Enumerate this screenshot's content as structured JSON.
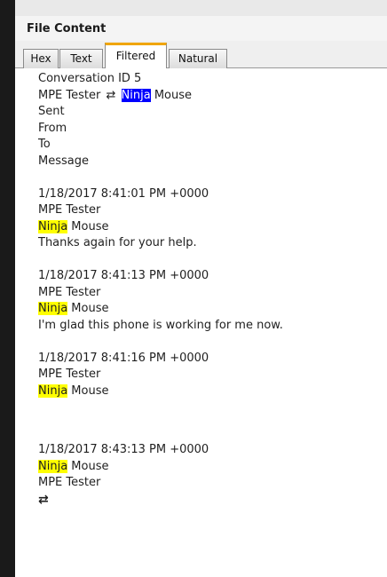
{
  "panel": {
    "title": "File Content"
  },
  "tabs": [
    {
      "label": "Hex"
    },
    {
      "label": "Text"
    },
    {
      "label": "Filtered"
    },
    {
      "label": "Natural"
    }
  ],
  "conversation": {
    "id_line": "Conversation ID 5",
    "participant_a": "MPE Tester",
    "swap_glyph": "⇄",
    "highlight_word": "Ninja",
    "participant_b_rest": " Mouse",
    "headers": [
      "Sent",
      "From",
      "To",
      "Message"
    ]
  },
  "messages": [
    {
      "sent": "1/18/2017 8:41:01 PM +0000",
      "from": "MPE Tester",
      "to_highlight": "Ninja",
      "to_rest": " Mouse",
      "text": "Thanks again for your help."
    },
    {
      "sent": "1/18/2017 8:41:13 PM +0000",
      "from": "MPE Tester",
      "to_highlight": "Ninja",
      "to_rest": " Mouse",
      "text": "I'm glad this phone is working for me now."
    },
    {
      "sent": "1/18/2017 8:41:16 PM +0000",
      "from": "MPE Tester",
      "to_highlight": "Ninja",
      "to_rest": " Mouse",
      "text": ""
    },
    {
      "sent": "1/18/2017 8:43:13 PM +0000",
      "from_highlight": "Ninja",
      "from_rest": " Mouse",
      "to": "MPE Tester",
      "text": "⇄"
    }
  ]
}
